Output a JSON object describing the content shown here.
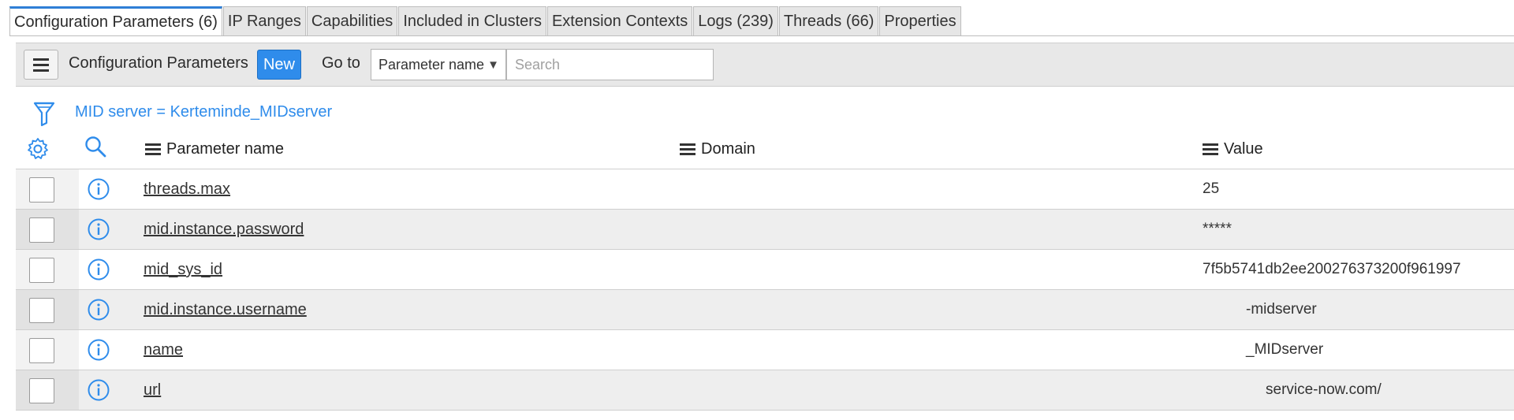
{
  "tabs": [
    {
      "label": "Configuration Parameters (6)",
      "active": true
    },
    {
      "label": "IP Ranges",
      "active": false
    },
    {
      "label": "Capabilities",
      "active": false
    },
    {
      "label": "Included in Clusters",
      "active": false
    },
    {
      "label": "Extension Contexts",
      "active": false
    },
    {
      "label": "Logs (239)",
      "active": false
    },
    {
      "label": "Threads (66)",
      "active": false
    },
    {
      "label": "Properties",
      "active": false
    }
  ],
  "toolbar": {
    "title": "Configuration Parameters",
    "new_label": "New",
    "goto_label": "Go to",
    "field_select": "Parameter name",
    "search_placeholder": "Search"
  },
  "filter": {
    "text": "MID server = Kerteminde_MIDserver"
  },
  "columns": {
    "parameter_name": "Parameter name",
    "domain": "Domain",
    "value": "Value"
  },
  "rows": [
    {
      "name": "threads.max",
      "domain": "",
      "value": "25"
    },
    {
      "name": "mid.instance.password",
      "domain": "",
      "value": "*****"
    },
    {
      "name": "mid_sys_id",
      "domain": "",
      "value": "7f5b5741db2ee200276373200f961997"
    },
    {
      "name": "mid.instance.username",
      "domain": "",
      "value": "-midserver"
    },
    {
      "name": "name",
      "domain": "",
      "value": "_MIDserver"
    },
    {
      "name": "url",
      "domain": "",
      "value": "service-now.com/"
    }
  ],
  "colors": {
    "accent": "#2f8ceb",
    "tab_active_border": "#2f7fd6"
  },
  "icons": {
    "menu": "hamburger-icon",
    "filter": "funnel-icon",
    "settings": "gear-icon",
    "search": "magnifier-icon",
    "info": "info-circle-icon"
  }
}
